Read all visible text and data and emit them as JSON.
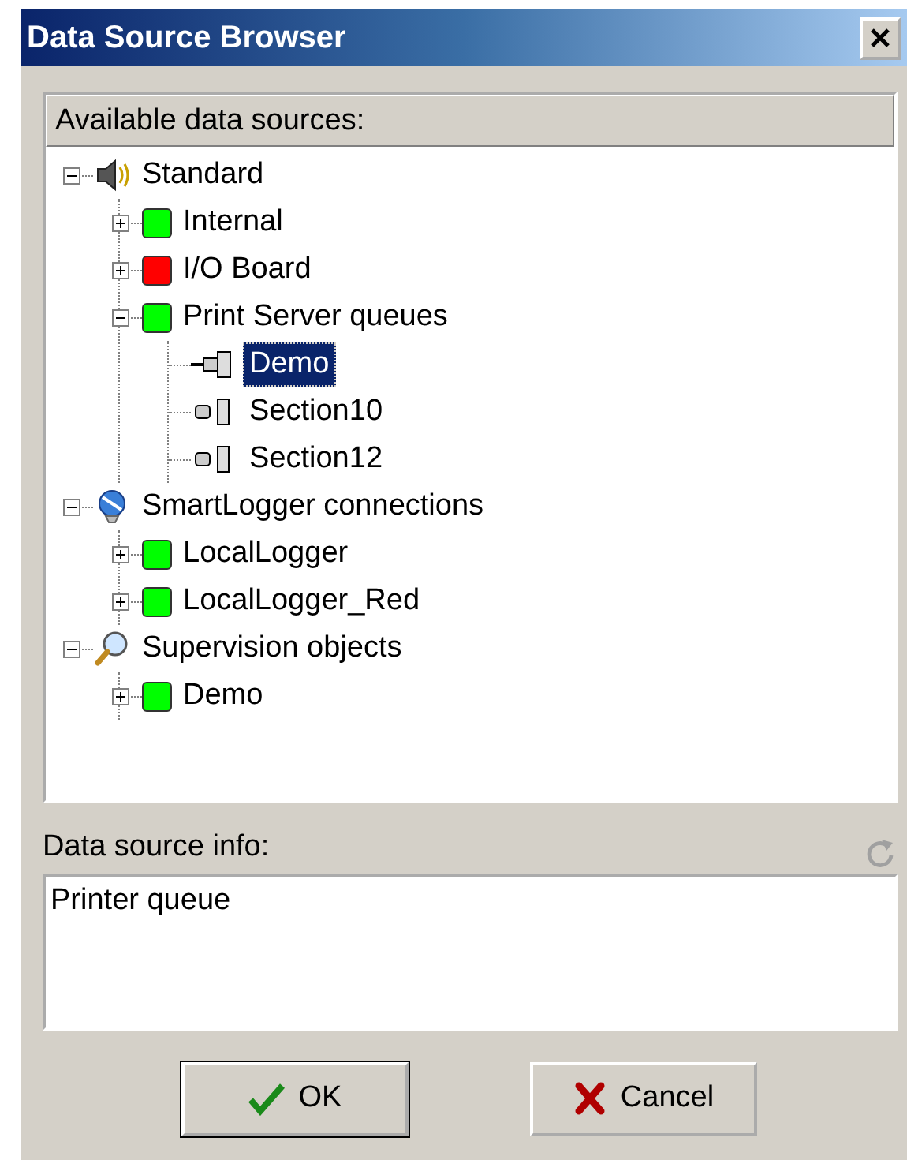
{
  "window": {
    "title": "Data Source Browser"
  },
  "tree": {
    "header": "Available data sources:",
    "nodes": [
      {
        "label": "Standard",
        "kind": "category",
        "expanded": true,
        "selected": false,
        "children": [
          {
            "label": "Internal",
            "kind": "source",
            "color": "#00ff00",
            "expanded": false,
            "selected": false
          },
          {
            "label": "I/O Board",
            "kind": "source",
            "color": "#ff0000",
            "expanded": false,
            "selected": false
          },
          {
            "label": "Print Server queues",
            "kind": "source",
            "color": "#00ff00",
            "expanded": true,
            "selected": false,
            "children": [
              {
                "label": "Demo",
                "kind": "queue",
                "connected": true,
                "selected": true
              },
              {
                "label": "Section10",
                "kind": "queue",
                "connected": false,
                "selected": false
              },
              {
                "label": "Section12",
                "kind": "queue",
                "connected": false,
                "selected": false
              }
            ]
          }
        ]
      },
      {
        "label": "SmartLogger connections",
        "kind": "category",
        "expanded": true,
        "selected": false,
        "children": [
          {
            "label": "LocalLogger",
            "kind": "source",
            "color": "#00ff00",
            "expanded": false,
            "selected": false
          },
          {
            "label": "LocalLogger_Red",
            "kind": "source",
            "color": "#00ff00",
            "expanded": false,
            "selected": false
          }
        ]
      },
      {
        "label": "Supervision objects",
        "kind": "category",
        "expanded": true,
        "selected": false,
        "children": [
          {
            "label": "Demo",
            "kind": "source",
            "color": "#00ff00",
            "expanded": false,
            "selected": false
          }
        ]
      }
    ]
  },
  "info": {
    "label": "Data source info:",
    "text": "Printer queue"
  },
  "buttons": [
    {
      "label": "OK",
      "kind": "ok",
      "default": true
    },
    {
      "label": "Cancel",
      "kind": "cancel",
      "default": false
    }
  ]
}
